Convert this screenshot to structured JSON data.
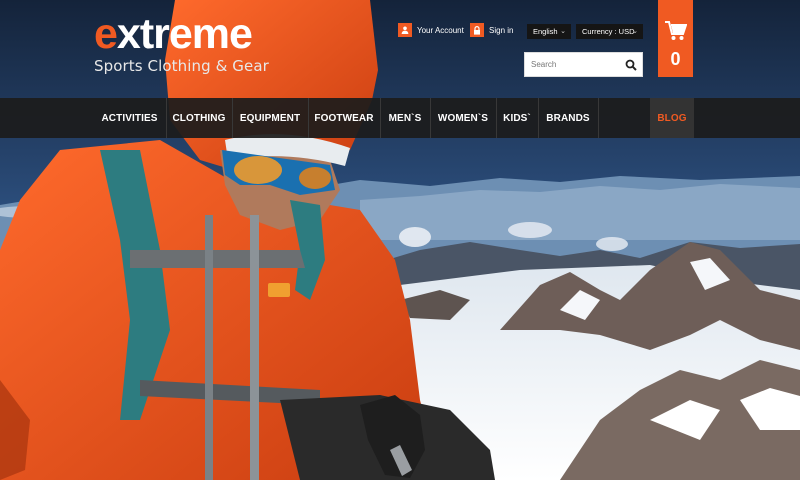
{
  "brand": {
    "logo_first": "e",
    "logo_rest": "xtreme",
    "tagline": "Sports Clothing & Gear"
  },
  "account": {
    "your_account": "Your Account",
    "sign_in": "Sign in"
  },
  "language": {
    "selected": "English"
  },
  "currency": {
    "selected": "Currency : USD"
  },
  "search": {
    "placeholder": "Search",
    "value": ""
  },
  "cart": {
    "count": "0"
  },
  "nav": {
    "items": [
      "ACTIVITIES",
      "CLOTHING",
      "EQUIPMENT",
      "FOOTWEAR",
      "MEN`S",
      "WOMEN`S",
      "KIDS`",
      "BRANDS"
    ],
    "blog": "BLOG"
  },
  "icons": {
    "account": "user-icon",
    "sign_in": "lock-icon",
    "search": "search-icon",
    "cart": "cart-icon",
    "dropdown": "chevron-down-icon"
  },
  "colors": {
    "accent": "#f05a22",
    "nav_bg": "#1c1c1c",
    "blog_bg": "#333333",
    "sky": "#2c4f7e",
    "snow": "#eef2f6"
  }
}
